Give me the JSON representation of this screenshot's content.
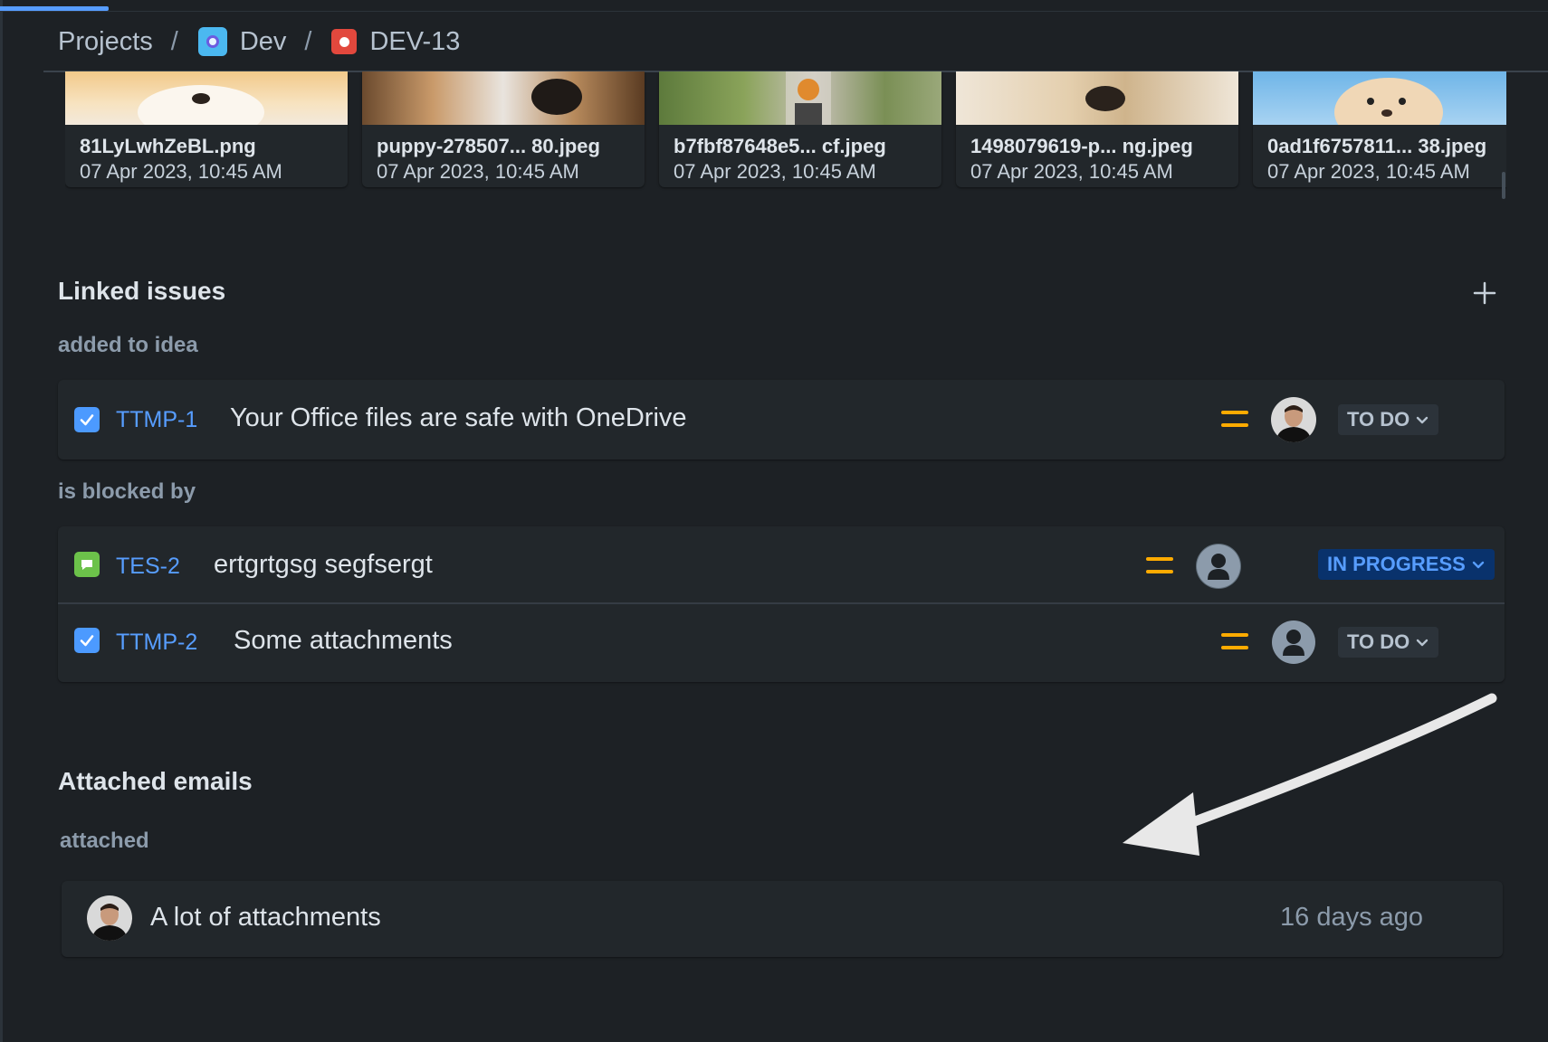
{
  "breadcrumb": {
    "projects": "Projects",
    "separator": "/",
    "project": "Dev",
    "project_icon": "project-avatar-icon",
    "issue": "DEV-13",
    "issue_icon": "bug-icon"
  },
  "attachments": [
    {
      "name": "81LyLwhZeBL.png",
      "date": "07 Apr 2023, 10:45 AM"
    },
    {
      "name": "puppy-278507... 80.jpeg",
      "date": "07 Apr 2023, 10:45 AM"
    },
    {
      "name": "b7fbf87648e5... cf.jpeg",
      "date": "07 Apr 2023, 10:45 AM"
    },
    {
      "name": "1498079619-p... ng.jpeg",
      "date": "07 Apr 2023, 10:45 AM"
    },
    {
      "name": "0ad1f6757811... 38.jpeg",
      "date": "07 Apr 2023, 10:45 AM"
    }
  ],
  "linked_issues": {
    "title": "Linked issues",
    "add_icon": "plus-icon",
    "groups": [
      {
        "label": "added to idea",
        "items": [
          {
            "key": "TTMP-1",
            "summary": "Your Office files are safe with OneDrive",
            "type": "task",
            "priority": "medium",
            "status": "TO DO"
          }
        ]
      },
      {
        "label": "is blocked by",
        "items": [
          {
            "key": "TES-2",
            "summary": "ertgrtgsg segfsergt",
            "type": "story",
            "priority": "medium",
            "status": "IN PROGRESS"
          },
          {
            "key": "TTMP-2",
            "summary": "Some attachments",
            "type": "task",
            "priority": "medium",
            "status": "TO DO"
          }
        ]
      }
    ]
  },
  "attached_emails": {
    "title": "Attached emails",
    "label": "attached",
    "items": [
      {
        "subject": "A lot of attachments",
        "time": "16 days ago"
      }
    ]
  },
  "colors": {
    "background": "#1d2125",
    "link": "#579dff",
    "priority_medium": "#ffab00",
    "in_progress_bg": "#09326c"
  }
}
